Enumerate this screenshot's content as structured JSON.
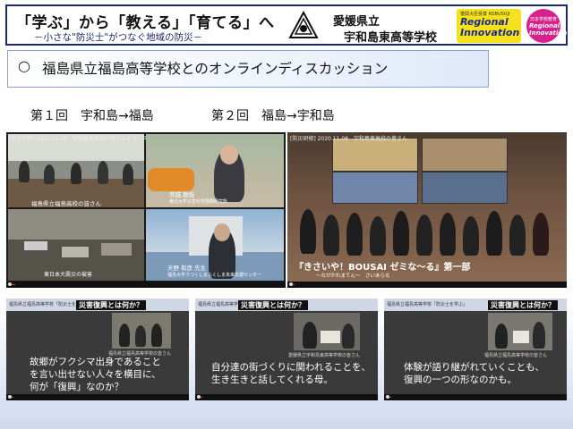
{
  "header": {
    "title": "「学ぶ」から「教える」「育てる」へ",
    "subtitle": "－小さな\"防災士\"がつなぐ地域の防災－",
    "prefecture": "愛媛県立",
    "school": "宇和島東高等学校",
    "badge_top": "復興大臣受賞 KOBUSUJI",
    "badge_main_1": "Regional",
    "badge_main_2": "Innovation",
    "circle_top": "日本学校教育",
    "circle_main_1": "Regional",
    "circle_main_2": "Innovation"
  },
  "section": {
    "bullet": "○",
    "heading": "福島県立福島高等学校とのオンラインディスカッション"
  },
  "sessions": {
    "first": "第１回　宇和島→福島",
    "second": "第２回　福島→宇和島"
  },
  "screens": {
    "left": {
      "tag": "[防災研修] 2020.11.08　宇和島東高校の皆さんとディスカッション",
      "cap_tl": "福島県立福島高校の皆さん",
      "cap_tr_name": "宮城 教授",
      "cap_tr_org": "東北大学災害科学国際研究所",
      "cap_bl": "東日本大震災の被害",
      "cap_br_name": "天野 和彦 先生",
      "cap_br_org": "福島大学うつくしまふくしま未来支援センター"
    },
    "right": {
      "tag": "[防災研修] 2020.11.08　宇和島東高校の皆さん",
      "caption": "『きさいや！BOUSAI ゼミな～る』第一部",
      "caption_sub": "～ながかれまてん～　さいあらな"
    }
  },
  "cards": [
    {
      "band": "福島県立福島高等学校「防災士を学ぶ」",
      "question": "災害復興とは何か？",
      "speaker": "福島県立福島高等学校の皆さん",
      "lines": [
        "故郷がフクシマ出身であること",
        "を言い出せない人々を横目に、",
        "何が「復興」なのか？"
      ]
    },
    {
      "band": "福島県立福島高等学校「防災士を学ぶ」",
      "question": "災害復興とは何か？",
      "speaker": "愛媛県立宇和島東高等学校の皆さん",
      "lines": [
        "自分達の街づくりに関われることを、",
        "生き生きと話してくれる母。"
      ]
    },
    {
      "band": "福島県立福島高等学校「防災士を学ぶ」",
      "question": "災害復興とは何か？",
      "speaker": "福島県立福島高等学校の皆さん",
      "lines": [
        "体験が語り継がれていくことも、",
        "復興の一つの形なのかも。"
      ]
    }
  ]
}
